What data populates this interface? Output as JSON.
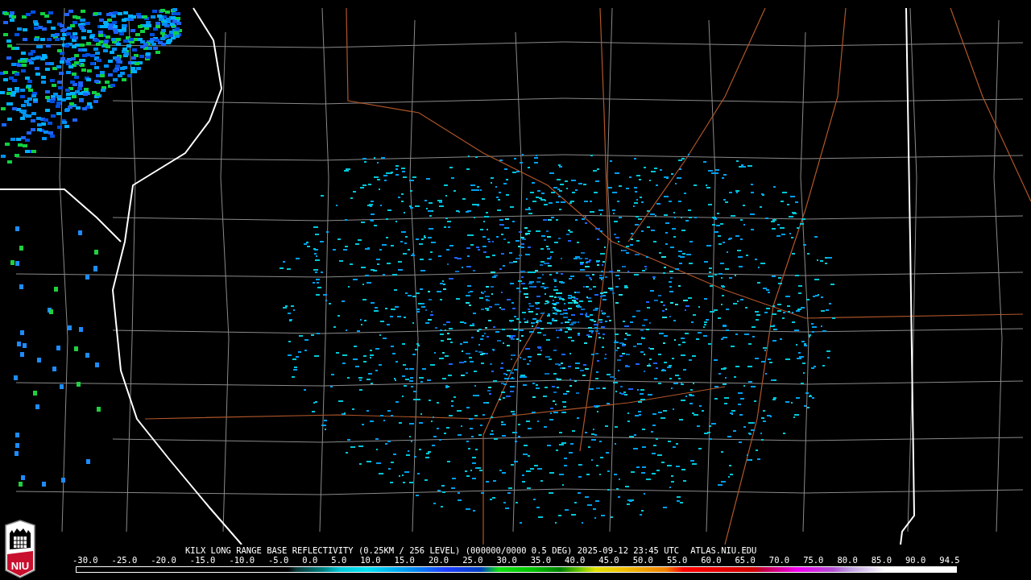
{
  "logo": {
    "text": "NIU"
  },
  "caption": {
    "product": "KILX LONG RANGE BASE REFLECTIVITY (0.25KM / 256 LEVEL) (000000/0000 0.5 DEG) 2025-09-12 23:45 UTC",
    "site": "ATLAS.NIU.EDU"
  },
  "color_scale": {
    "labels": [
      "-30.0",
      "-25.0",
      "-20.0",
      "-15.0",
      "-10.0",
      "-5.0",
      "0.0",
      "5.0",
      "10.0",
      "15.0",
      "20.0",
      "25.0",
      "30.0",
      "35.0",
      "40.0",
      "45.0",
      "50.0",
      "55.0",
      "60.0",
      "65.0",
      "70.0",
      "75.0",
      "80.0",
      "85.0",
      "90.0",
      "94.5"
    ]
  }
}
